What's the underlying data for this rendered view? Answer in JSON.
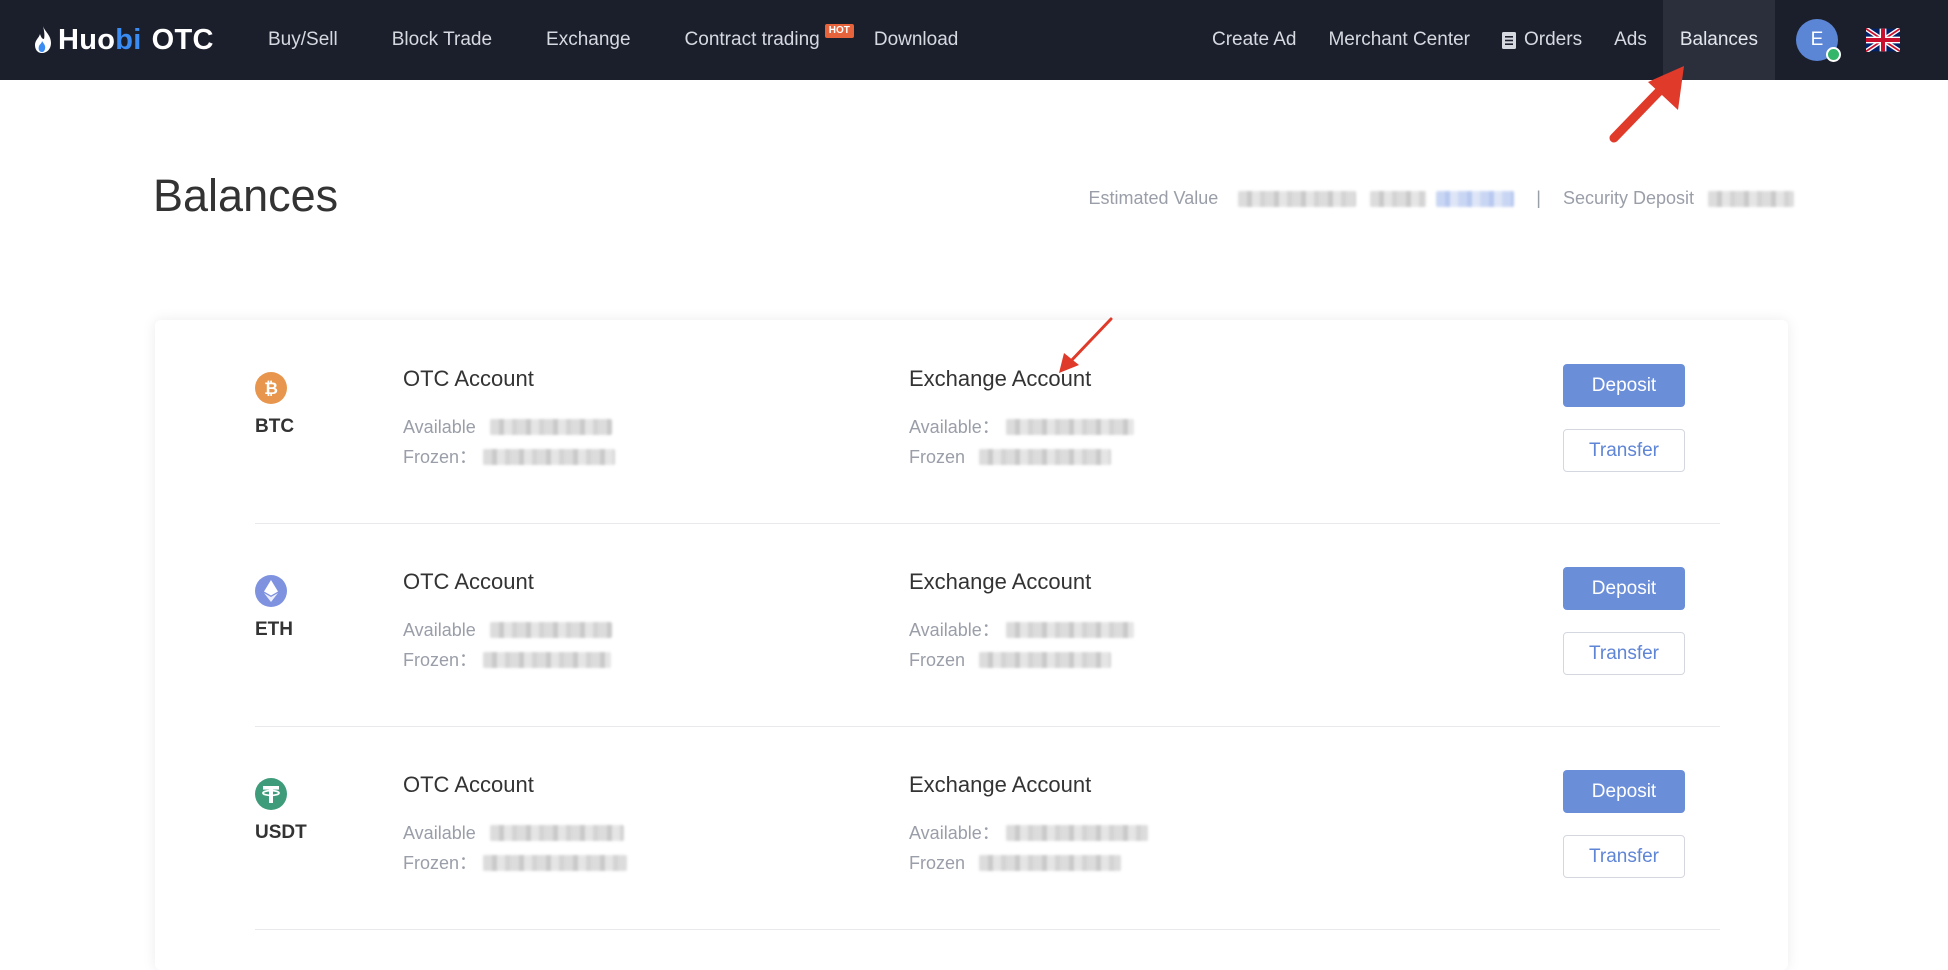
{
  "nav": {
    "brand_main": "Huo",
    "brand_accent": "bi",
    "brand_suffix": "OTC",
    "links": [
      {
        "label": "Buy/Sell"
      },
      {
        "label": "Block Trade"
      },
      {
        "label": "Exchange"
      },
      {
        "label": "Contract trading",
        "badge": "HOT"
      },
      {
        "label": "Download"
      }
    ],
    "right_links": {
      "create_ad": "Create Ad",
      "merchant_center": "Merchant Center",
      "orders": "Orders",
      "ads": "Ads",
      "balances": "Balances"
    },
    "avatar_initial": "E",
    "active": "Balances"
  },
  "page": {
    "title": "Balances",
    "estimated_value_label": "Estimated Value",
    "separator": "|",
    "security_deposit_label": "Security Deposit"
  },
  "accounts": [
    {
      "coin": "BTC",
      "icon": "bitcoin-icon",
      "color": "#e8964d",
      "otc": {
        "title": "OTC Account",
        "available_label": "Available",
        "frozen_label": "Frozen："
      },
      "exchange": {
        "title": "Exchange Account",
        "available_label": "Available：",
        "frozen_label": "Frozen"
      },
      "deposit": "Deposit",
      "transfer": "Transfer"
    },
    {
      "coin": "ETH",
      "icon": "ethereum-icon",
      "color": "#7e92e0",
      "otc": {
        "title": "OTC Account",
        "available_label": "Available",
        "frozen_label": "Frozen："
      },
      "exchange": {
        "title": "Exchange Account",
        "available_label": "Available：",
        "frozen_label": "Frozen"
      },
      "deposit": "Deposit",
      "transfer": "Transfer"
    },
    {
      "coin": "USDT",
      "icon": "tether-icon",
      "color": "#3f9c7a",
      "otc": {
        "title": "OTC Account",
        "available_label": "Available",
        "frozen_label": "Frozen："
      },
      "exchange": {
        "title": "Exchange Account",
        "available_label": "Available：",
        "frozen_label": "Frozen"
      },
      "deposit": "Deposit",
      "transfer": "Transfer"
    }
  ],
  "colors": {
    "nav_bg": "#1b1f2c",
    "primary": "#6b8ed9",
    "annotation": "#e03a2a"
  }
}
